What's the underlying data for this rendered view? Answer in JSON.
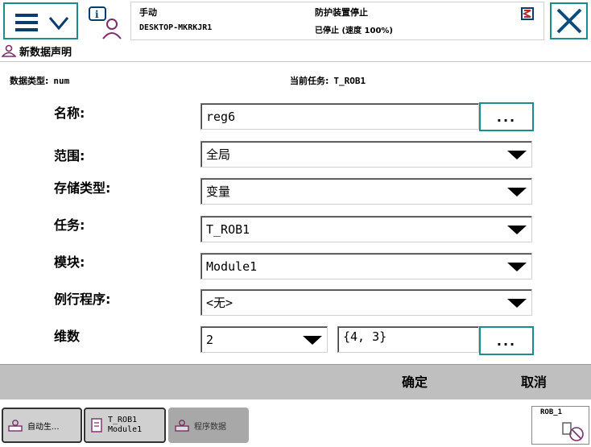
{
  "header": {
    "mode": "手动",
    "controller": "DESKTOP-MKRKJR1",
    "safety_state": "防护装置停止",
    "run_state": "已停止 (速度 100%)"
  },
  "page": {
    "title": "新数据声明"
  },
  "info": {
    "data_type_label": "数据类型:",
    "data_type_value": "num",
    "task_label": "当前任务:",
    "task_value": "T_ROB1"
  },
  "form": {
    "name_label": "名称:",
    "name_value": "reg6",
    "name_btn": "...",
    "scope_label": "范围:",
    "scope_value": "全局",
    "storage_label": "存储类型:",
    "storage_value": "变量",
    "task_label": "任务:",
    "task_value": "T_ROB1",
    "module_label": "模块:",
    "module_value": "Module1",
    "routine_label": "例行程序:",
    "routine_value": "<无>",
    "dim_label": "维数",
    "dim_value": "2",
    "dim_size": "{4, 3}",
    "dim_btn": "..."
  },
  "commands": {
    "ok": "确定",
    "cancel": "取消"
  },
  "taskbar": {
    "t1": "自动生...",
    "t2_line1": "T_ROB1",
    "t2_line2": "Module1",
    "t3": "程序数据",
    "robot": "ROB_1"
  },
  "colors": {
    "accent": "#1a8c8c",
    "command_bar": "#bfbfbf"
  }
}
